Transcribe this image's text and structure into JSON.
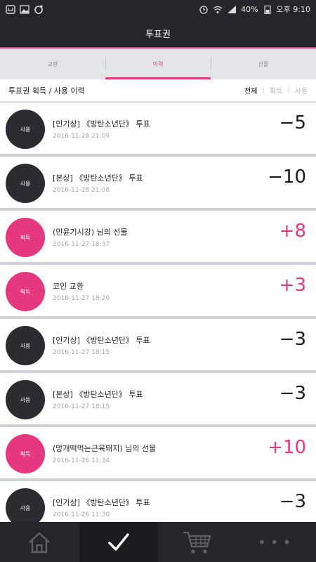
{
  "status_bar": {
    "battery": "40%",
    "time": "오후 9:10"
  },
  "header": {
    "title": "투표권"
  },
  "tabs": [
    {
      "label": "교환",
      "active": false
    },
    {
      "label": "이력",
      "active": true
    },
    {
      "label": "선물",
      "active": false
    }
  ],
  "history": {
    "title": "투표권 획득 / 사용 이력",
    "filters": [
      {
        "label": "전체",
        "active": true
      },
      {
        "label": "획득",
        "active": false
      },
      {
        "label": "사용",
        "active": false
      }
    ]
  },
  "items": [
    {
      "badge": "사용",
      "type": "use",
      "title": "[인기상] 《방탄소년단》 투표",
      "date": "2016-11-28 21:09",
      "amount": "−5"
    },
    {
      "badge": "사용",
      "type": "use",
      "title": "[본상] 《방탄소년단》 투표",
      "date": "2016-11-28 21:08",
      "amount": "−10"
    },
    {
      "badge": "획득",
      "type": "gain",
      "title": "(민윤기시강) 님의 선물",
      "date": "2016-11-27 18:37",
      "amount": "+8"
    },
    {
      "badge": "획득",
      "type": "gain",
      "title": "코인 교환",
      "date": "2016-11-27 18:20",
      "amount": "+3"
    },
    {
      "badge": "사용",
      "type": "use",
      "title": "[인기상] 《방탄소년단》 투표",
      "date": "2016-11-27 18:15",
      "amount": "−3"
    },
    {
      "badge": "사용",
      "type": "use",
      "title": "[본상] 《방탄소년단》 투표",
      "date": "2016-11-27 18:15",
      "amount": "−3"
    },
    {
      "badge": "획득",
      "type": "gain",
      "title": "(망개떡먹는근육돼지) 님의 선물",
      "date": "2016-11-26 11:34",
      "amount": "+10"
    },
    {
      "badge": "사용",
      "type": "use",
      "title": "[인기상] 《방탄소년단》 투표",
      "date": "2016-11-26 11:30",
      "amount": "−3"
    }
  ],
  "bottom_nav": [
    {
      "icon": "home-icon",
      "active": false
    },
    {
      "icon": "check-icon",
      "active": true
    },
    {
      "icon": "cart-icon",
      "active": false
    },
    {
      "icon": "more-icon",
      "active": false
    }
  ],
  "colors": {
    "accent": "#e6387e",
    "dark": "#24262b",
    "use_badge": "#2a2c31"
  }
}
